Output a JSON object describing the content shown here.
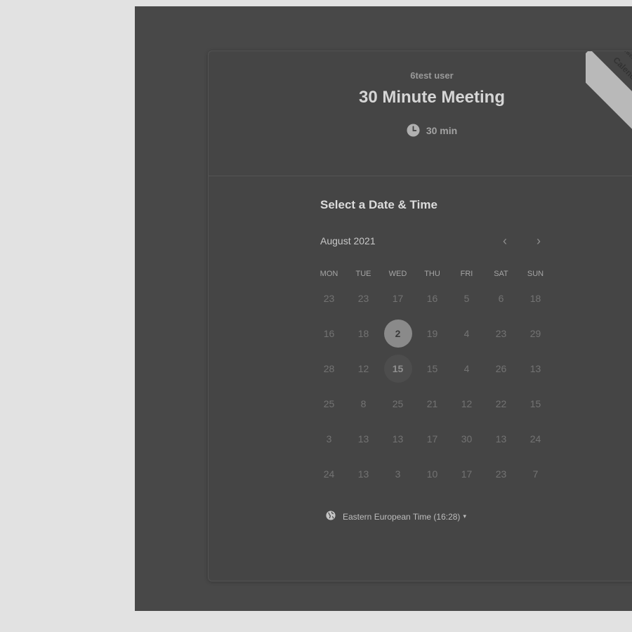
{
  "event": {
    "organizer": "6test user",
    "title": "30 Minute Meeting",
    "duration": "30 min"
  },
  "badge": {
    "line1": "POWERED BY",
    "line2": "Calendly"
  },
  "calendar": {
    "heading": "Select a Date & Time",
    "month": "August 2021",
    "prev_symbol": "‹",
    "next_symbol": "›",
    "weekdays": [
      "MON",
      "TUE",
      "WED",
      "THU",
      "FRI",
      "SAT",
      "SUN"
    ],
    "weeks": [
      [
        "23",
        "23",
        "17",
        "16",
        "5",
        "6",
        "18"
      ],
      [
        "16",
        "18",
        "2",
        "19",
        "4",
        "23",
        "29"
      ],
      [
        "28",
        "12",
        "15",
        "15",
        "4",
        "26",
        "13"
      ],
      [
        "25",
        "8",
        "25",
        "21",
        "12",
        "22",
        "15"
      ],
      [
        "3",
        "13",
        "13",
        "17",
        "30",
        "13",
        "24"
      ],
      [
        "24",
        "13",
        "3",
        "10",
        "17",
        "23",
        "7"
      ]
    ],
    "selected_day": "2",
    "today": "15"
  },
  "timezone": {
    "label": "Eastern European Time (16:28)",
    "caret": "▾"
  },
  "icons": {
    "clock": "clock-icon",
    "globe": "globe-icon"
  }
}
